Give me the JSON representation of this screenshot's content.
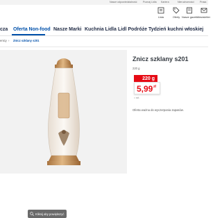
{
  "top_links": [
    "Nasze odpowiedzialność",
    "Poznaj Lidla",
    "Kariera",
    "Nieruchomości",
    "Prasa"
  ],
  "header_icons": [
    {
      "name": "lista-icon",
      "label": "Lista"
    },
    {
      "name": "oferty-icon",
      "label": "Oferty"
    },
    {
      "name": "gazetki-icon",
      "label": "Nasze gazetki"
    },
    {
      "name": "newsletter-icon",
      "label": "Newsletter"
    }
  ],
  "nav": [
    {
      "label": "cza",
      "active": false
    },
    {
      "label": "Oferta Non-food",
      "active": true
    },
    {
      "label": "Nasze Marki",
      "active": false
    },
    {
      "label": "Kuchnia Lidla",
      "active": false
    },
    {
      "label": "Lidl Podróże",
      "active": false
    },
    {
      "label": "Tydzień kuchni włoskiej",
      "active": false
    }
  ],
  "breadcrumbs": [
    "enicy",
    "Znicz szklany s201"
  ],
  "zoom_label": "Kliknij aby powiększyć",
  "product": {
    "title": "Znicz szklany s201",
    "weight": "220 g",
    "old_price": "220 g",
    "price_main": "5,99",
    "price_currency": "zł",
    "unit_note": "= szt.",
    "offer_note": "Oferta ważna do wyczerpania zapasów."
  },
  "colors": {
    "brand_blue": "#0050aa",
    "price_red": "#e60a14"
  }
}
